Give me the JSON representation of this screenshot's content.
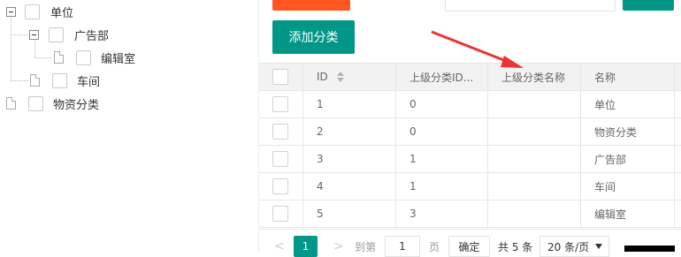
{
  "tree": {
    "nodes": [
      {
        "label": "单位"
      },
      {
        "label": "广告部"
      },
      {
        "label": "编辑室"
      },
      {
        "label": "车间"
      },
      {
        "label": "物资分类"
      }
    ]
  },
  "toolbar": {
    "add_label": "添加分类"
  },
  "table": {
    "columns": [
      "ID",
      "上级分类ID...",
      "上级分类名称",
      "名称"
    ],
    "rows": [
      {
        "id": "1",
        "parent_id": "0",
        "parent_name": "",
        "name": "单位"
      },
      {
        "id": "2",
        "parent_id": "0",
        "parent_name": "",
        "name": "物资分类"
      },
      {
        "id": "3",
        "parent_id": "1",
        "parent_name": "",
        "name": "广告部"
      },
      {
        "id": "4",
        "parent_id": "1",
        "parent_name": "",
        "name": "车间"
      },
      {
        "id": "5",
        "parent_id": "3",
        "parent_name": "",
        "name": "编辑室"
      }
    ]
  },
  "pager": {
    "prev": "<",
    "current": "1",
    "next": ">",
    "goto_label": "到第",
    "goto_value": "1",
    "page_unit": "页",
    "confirm_label": "确定",
    "total_label": "共 5 条",
    "page_size": "20 条/页"
  },
  "colors": {
    "primary": "#009688",
    "orange": "#ff5722",
    "annotation_arrow": "#ee3333"
  },
  "icons": [
    "minus-toggle-icon",
    "file-icon",
    "sort-icon",
    "chevron-down-icon",
    "red-arrow-annotation"
  ]
}
